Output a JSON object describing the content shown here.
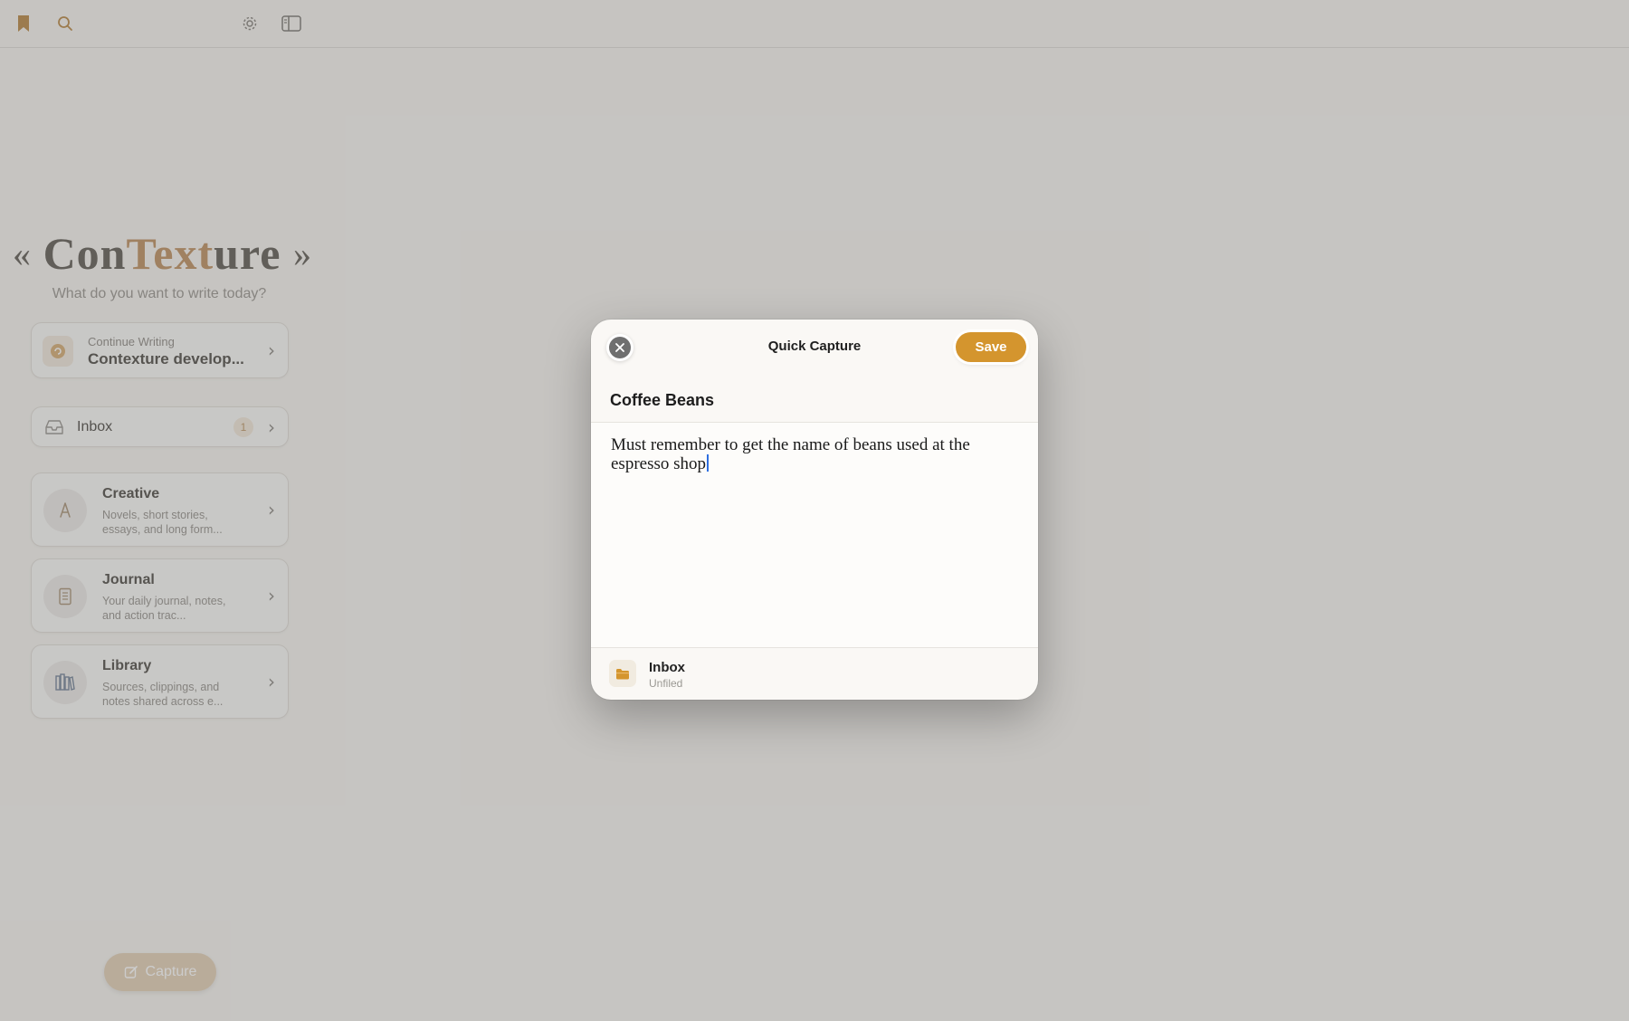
{
  "toolbar": {
    "icons": [
      "bookmark-icon",
      "search-icon",
      "gear-icon",
      "sidebar-toggle-icon"
    ]
  },
  "brand": {
    "left_quote": "«",
    "name_part1": "Con",
    "name_part2": "Text",
    "name_part3": "ure",
    "right_quote": "»",
    "tagline": "What do you want to write today?"
  },
  "continue": {
    "kicker": "Continue Writing",
    "title": "Contexture develop..."
  },
  "inbox": {
    "label": "Inbox",
    "count": "1"
  },
  "folders": [
    {
      "title": "Creative",
      "description": "Novels, short stories, essays, and long form...",
      "icon": "pen-nib-icon"
    },
    {
      "title": "Journal",
      "description": "Your daily journal, notes, and action trac...",
      "icon": "notebook-icon"
    },
    {
      "title": "Library",
      "description": "Sources, clippings, and notes shared across e...",
      "icon": "books-icon"
    }
  ],
  "capture": {
    "label": "Capture"
  },
  "modal": {
    "title": "Quick Capture",
    "save_label": "Save",
    "note_title": "Coffee Beans",
    "note_body": "Must remember to get the name of beans used at the espresso shop",
    "destination": {
      "name": "Inbox",
      "subtitle": "Unfiled"
    }
  },
  "colors": {
    "accent": "#d4952e",
    "brand_accent": "#c9a27a",
    "caret": "#2f6fe0"
  }
}
